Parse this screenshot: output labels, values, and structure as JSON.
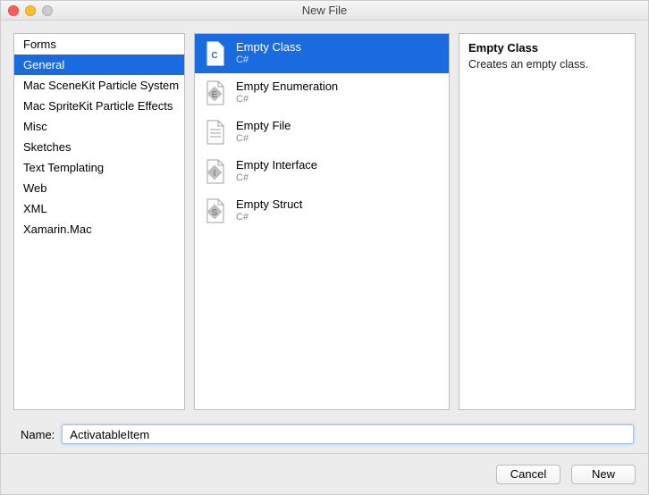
{
  "window": {
    "title": "New File"
  },
  "categories": {
    "items": [
      {
        "label": "Forms"
      },
      {
        "label": "General"
      },
      {
        "label": "Mac SceneKit Particle System"
      },
      {
        "label": "Mac SpriteKit Particle Effects"
      },
      {
        "label": "Misc"
      },
      {
        "label": "Sketches"
      },
      {
        "label": "Text Templating"
      },
      {
        "label": "Web"
      },
      {
        "label": "XML"
      },
      {
        "label": "Xamarin.Mac"
      }
    ],
    "selected_index": 1
  },
  "templates": {
    "items": [
      {
        "label": "Empty Class",
        "lang": "C#",
        "icon": "C"
      },
      {
        "label": "Empty Enumeration",
        "lang": "C#",
        "icon": "E"
      },
      {
        "label": "Empty File",
        "lang": "C#",
        "icon": "F"
      },
      {
        "label": "Empty Interface",
        "lang": "C#",
        "icon": "I"
      },
      {
        "label": "Empty Struct",
        "lang": "C#",
        "icon": "S"
      }
    ],
    "selected_index": 0
  },
  "description": {
    "title": "Empty Class",
    "body": "Creates an empty class."
  },
  "name_field": {
    "label": "Name:",
    "value": "ActivatableItem"
  },
  "buttons": {
    "cancel": "Cancel",
    "new": "New"
  },
  "colors": {
    "selection": "#1a6be0"
  }
}
